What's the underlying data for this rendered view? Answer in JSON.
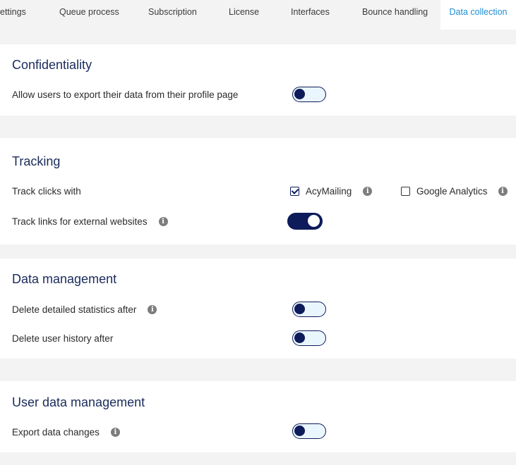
{
  "tabs": [
    {
      "label": "ettings"
    },
    {
      "label": "Queue process"
    },
    {
      "label": "Subscription"
    },
    {
      "label": "License"
    },
    {
      "label": "Interfaces"
    },
    {
      "label": "Bounce handling"
    },
    {
      "label": "Data collection",
      "active": true
    }
  ],
  "confidentiality": {
    "title": "Confidentiality",
    "export_label": "Allow users to export their data from their profile page",
    "export_enabled": false
  },
  "tracking": {
    "title": "Tracking",
    "track_clicks_label": "Track clicks with",
    "options": [
      {
        "label": "AcyMailing",
        "checked": true
      },
      {
        "label": "Google Analytics",
        "checked": false
      }
    ],
    "external_label": "Track links for external websites",
    "external_enabled": true
  },
  "data_management": {
    "title": "Data management",
    "delete_stats_label": "Delete detailed statistics after",
    "delete_stats_enabled": false,
    "delete_history_label": "Delete user history after",
    "delete_history_enabled": false
  },
  "user_data_management": {
    "title": "User data management",
    "export_changes_label": "Export data changes",
    "export_changes_enabled": false
  },
  "icons": {
    "info": "info-icon",
    "check": "check-icon"
  },
  "colors": {
    "accent": "#0e1b5a",
    "active_tab": "#1f8dd6",
    "toggle_off_bg": "#eaf6fd"
  }
}
